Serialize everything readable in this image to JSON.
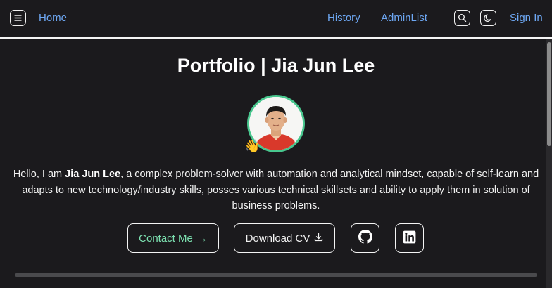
{
  "nav": {
    "home": "Home",
    "history": "History",
    "adminlist": "AdminList",
    "signin": "Sign In",
    "menu_icon": "menu-icon",
    "search_icon": "search-icon",
    "theme_icon": "moon-icon"
  },
  "hero": {
    "title": "Portfolio | Jia Jun Lee",
    "wave": "👋",
    "bio_prefix": "Hello, I am ",
    "bio_name": "Jia Jun Lee",
    "bio_rest": ", a complex problem-solver with automation and analytical mindset, capable of self-learn and adapts to new technology/industry skills, posses various technical skillsets and ability to apply them in solution of business problems."
  },
  "buttons": {
    "contact": "Contact Me",
    "contact_arrow": "→",
    "download_cv": "Download CV",
    "github_icon": "github-icon",
    "linkedin_icon": "linkedin-icon"
  },
  "colors": {
    "background": "#1b1a1d",
    "link": "#6ea8f4",
    "accent_green": "#48c78e",
    "contact_text": "#7ce0b0"
  }
}
